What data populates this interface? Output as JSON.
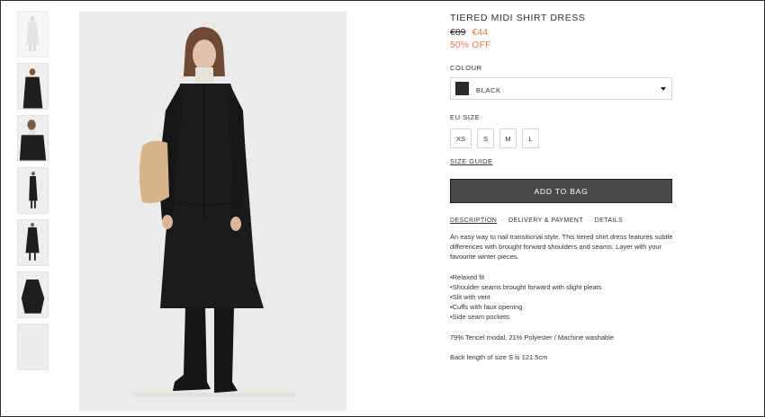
{
  "product": {
    "title": "TIERED MIDI SHIRT DRESS",
    "old_price": "€89",
    "new_price": "€44",
    "discount": "50% OFF"
  },
  "colour": {
    "label": "COLOUR",
    "selected": "BLACK",
    "swatch_color": "#2a2a2a"
  },
  "size": {
    "label": "EU SIZE",
    "options": [
      "XS",
      "S",
      "M",
      "L"
    ],
    "guide_label": "SIZE GUIDE"
  },
  "cart": {
    "add_label": "ADD TO BAG"
  },
  "tabs": {
    "description": "DESCRIPTION",
    "delivery": "DELIVERY & PAYMENT",
    "details": "DETAILS",
    "separator": "·"
  },
  "description": {
    "intro": "An easy way to nail transitional style. This tiered shirt dress features subtle differences with brought forward shoulders and seams. Layer with your favourite winter pieces.",
    "features": [
      "Relaxed fit",
      "Shoulder seams brought forward with slight pleats",
      "Slit with vent",
      "Cuffs with faux opening",
      "Side seam pockets"
    ],
    "composition": "79% Tencel modal, 21% Polyester / Machine washable",
    "length": "Back length of size S is 121.5cm"
  },
  "colors": {
    "accent_sale": "#e8734a",
    "button_bg": "#4a4a4a"
  }
}
